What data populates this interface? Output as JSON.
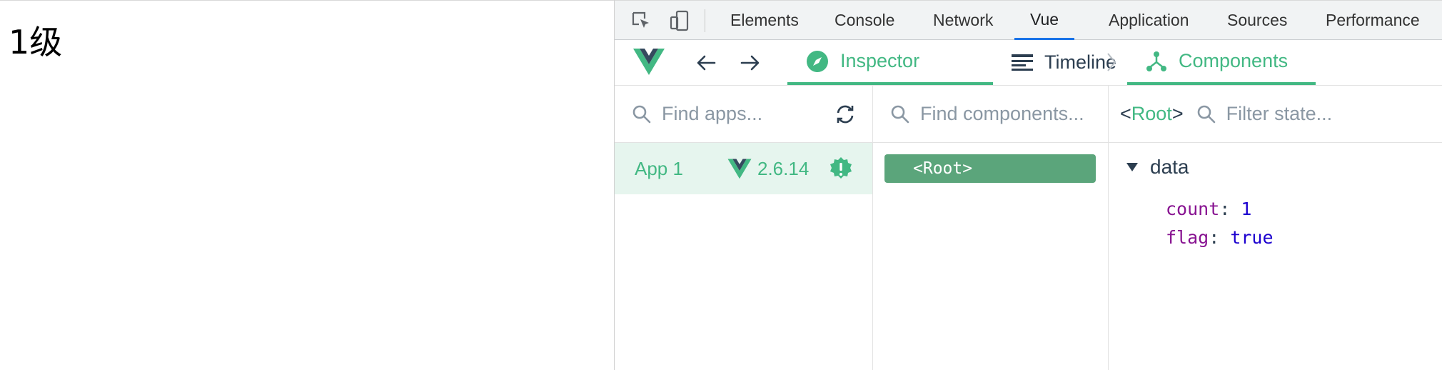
{
  "page": {
    "heading": "1级"
  },
  "devtools_tabs": [
    "Elements",
    "Console",
    "Network",
    "Vue",
    "Application",
    "Sources",
    "Performance"
  ],
  "active_devtools_tab": "Vue",
  "vue_toolbar": {
    "inspector_label": "Inspector",
    "timeline_label": "Timeline",
    "components_label": "Components"
  },
  "apps_panel": {
    "search_placeholder": "Find apps...",
    "app": {
      "name": "App 1",
      "version": "2.6.14"
    }
  },
  "components_panel": {
    "search_placeholder": "Find components...",
    "root_label": "<Root>"
  },
  "state_panel": {
    "root_open": "<",
    "root_name": "Root",
    "root_close": ">",
    "search_placeholder": "Filter state...",
    "section": "data",
    "fields": [
      {
        "key": "count",
        "value": "1"
      },
      {
        "key": "flag",
        "value": "true"
      }
    ]
  },
  "colors": {
    "vue_green": "#42b883",
    "vue_dark": "#35495e",
    "chrome_blue": "#1a73e8"
  }
}
